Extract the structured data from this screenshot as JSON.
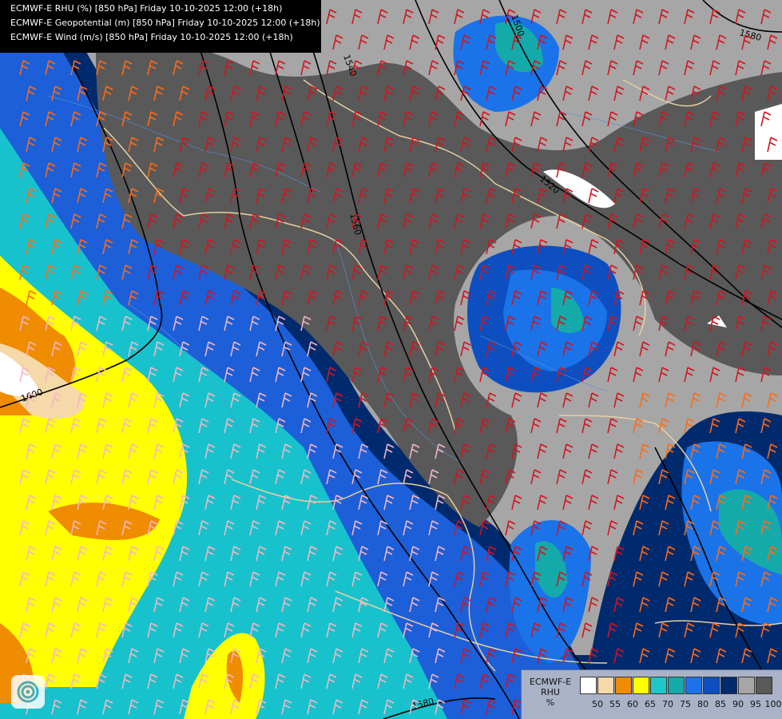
{
  "header": {
    "lines": [
      "ECMWF-E RHU (%) [850 hPa] Friday 10-10-2025 12:00 (+18h)",
      "ECMWF-E Geopotential (m) [850 hPa] Friday 10-10-2025 12:00 (+18h)",
      "ECMWF-E Wind (m/s) [850 hPa] Friday 10-10-2025 12:00 (+18h)"
    ]
  },
  "legend": {
    "title_line1": "ECMWF-E",
    "title_line2": "RHU",
    "unit": "%",
    "ticks": [
      "50",
      "55",
      "60",
      "65",
      "70",
      "75",
      "80",
      "85",
      "90",
      "95",
      "100"
    ],
    "colors": [
      "#ffffff",
      "#f5d9a8",
      "#f08c00",
      "#ffff00",
      "#1ec8c8",
      "#14aaaa",
      "#1a73e8",
      "#0d4fc0",
      "#002a6e",
      "#a6a6a6",
      "#595959"
    ]
  },
  "contours": {
    "labels": [
      "1540",
      "1500",
      "1560",
      "1520",
      "1600",
      "1580",
      "1580"
    ]
  },
  "icons": {
    "logo": "ecmwf-swirl-icon"
  }
}
